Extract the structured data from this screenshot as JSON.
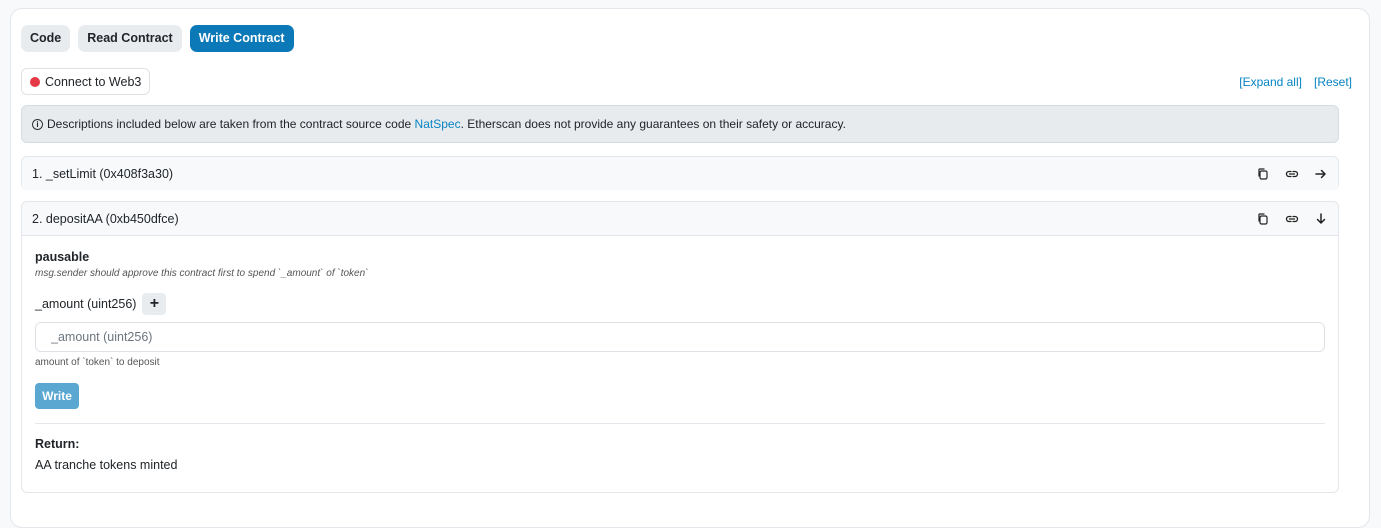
{
  "tabs": [
    {
      "label": "Code"
    },
    {
      "label": "Read Contract"
    },
    {
      "label": "Write Contract"
    }
  ],
  "connect": {
    "label": "Connect to Web3",
    "status_color": "#e63946"
  },
  "links": {
    "expand_all": "[Expand all]",
    "reset": "[Reset]"
  },
  "notice": {
    "prefix": "Descriptions included below are taken from the contract source code ",
    "link": "NatSpec",
    "suffix": ". Etherscan does not provide any guarantees on their safety or accuracy."
  },
  "functions": [
    {
      "title": "1. _setLimit (0x408f3a30)",
      "expand_icon": "arrow-right-icon"
    },
    {
      "title": "2. depositAA (0xb450dfce)",
      "expand_icon": "arrow-down-icon",
      "name": "pausable",
      "note": "msg.sender should approve this contract first to spend `_amount` of `token`",
      "param_label": "_amount (uint256)",
      "param_placeholder": "_amount (uint256)",
      "param_help": "amount of `token` to deposit",
      "write_label": "Write",
      "return_title": "Return:",
      "return_value": "AA tranche tokens minted"
    }
  ],
  "colors": {
    "accent": "#0b78b8",
    "link": "#0784c3",
    "write_button": "#5aa7d2"
  }
}
